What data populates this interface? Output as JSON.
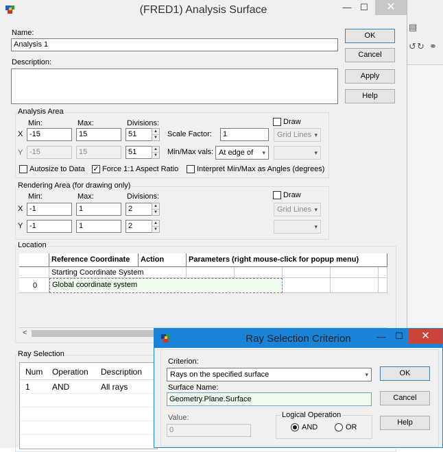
{
  "background_app": {
    "toolbar_icons": [
      "document-icon",
      "undo-icon",
      "redo-icon",
      "binoculars-icon"
    ]
  },
  "main_window": {
    "title": "(FRED1) Analysis Surface",
    "minimize": "—",
    "maximize": "☐",
    "close": "✕",
    "name_label": "Name:",
    "name_value": "Analysis 1",
    "description_label": "Description:",
    "description_value": "",
    "buttons": {
      "ok": "OK",
      "cancel": "Cancel",
      "apply": "Apply",
      "help": "Help"
    },
    "analysis_area": {
      "title": "Analysis Area",
      "min_label": "Min:",
      "max_label": "Max:",
      "div_label": "Divisions:",
      "x_label": "X",
      "y_label": "Y",
      "x_min": "-15",
      "x_max": "15",
      "x_div": "51",
      "y_min": "-15",
      "y_max": "15",
      "y_div": "51",
      "scale_factor_label": "Scale Factor:",
      "scale_factor_value": "1",
      "minmax_label": "Min/Max vals:",
      "minmax_value": "At edge of",
      "draw_label": "Draw",
      "grid_lines": "Grid Lines",
      "autosize_label": "Autosize to Data",
      "force_label": "Force 1:1 Aspect Ratio",
      "interpret_label": "Interpret Min/Max as Angles (degrees)"
    },
    "rendering_area": {
      "title": "Rendering Area (for drawing only)",
      "min_label": "Min:",
      "max_label": "Max:",
      "div_label": "Divisions:",
      "x_label": "X",
      "y_label": "Y",
      "x_min": "-1",
      "x_max": "1",
      "x_div": "2",
      "y_min": "-1",
      "y_max": "1",
      "y_div": "2",
      "draw_label": "Draw",
      "grid_lines": "Grid Lines"
    },
    "location": {
      "title": "Location",
      "headers": [
        "Reference Coordinate",
        "Action",
        "Parameters (right mouse-click for popup menu)"
      ],
      "rows": [
        {
          "num": "",
          "ref": "Starting Coordinate System"
        },
        {
          "num": "0",
          "ref": "Global coordinate system"
        }
      ],
      "scroll_left": "<"
    },
    "ray_selection": {
      "title": "Ray Selection",
      "headers": [
        "Num",
        "Operation",
        "Description"
      ],
      "rows": [
        {
          "num": "1",
          "operation": "AND",
          "description": "All rays"
        }
      ]
    }
  },
  "ray_dialog": {
    "title": "Ray Selection Criterion",
    "minimize": "—",
    "maximize": "☐",
    "close": "✕",
    "criterion_label": "Criterion:",
    "criterion_value": "Rays on the specified surface",
    "surface_name_label": "Surface Name:",
    "surface_name_value": "Geometry.Plane.Surface",
    "value_label": "Value:",
    "value_value": "0",
    "logical_label": "Logical Operation",
    "and_label": "AND",
    "or_label": "OR",
    "buttons": {
      "ok": "OK",
      "cancel": "Cancel",
      "help": "Help"
    }
  }
}
